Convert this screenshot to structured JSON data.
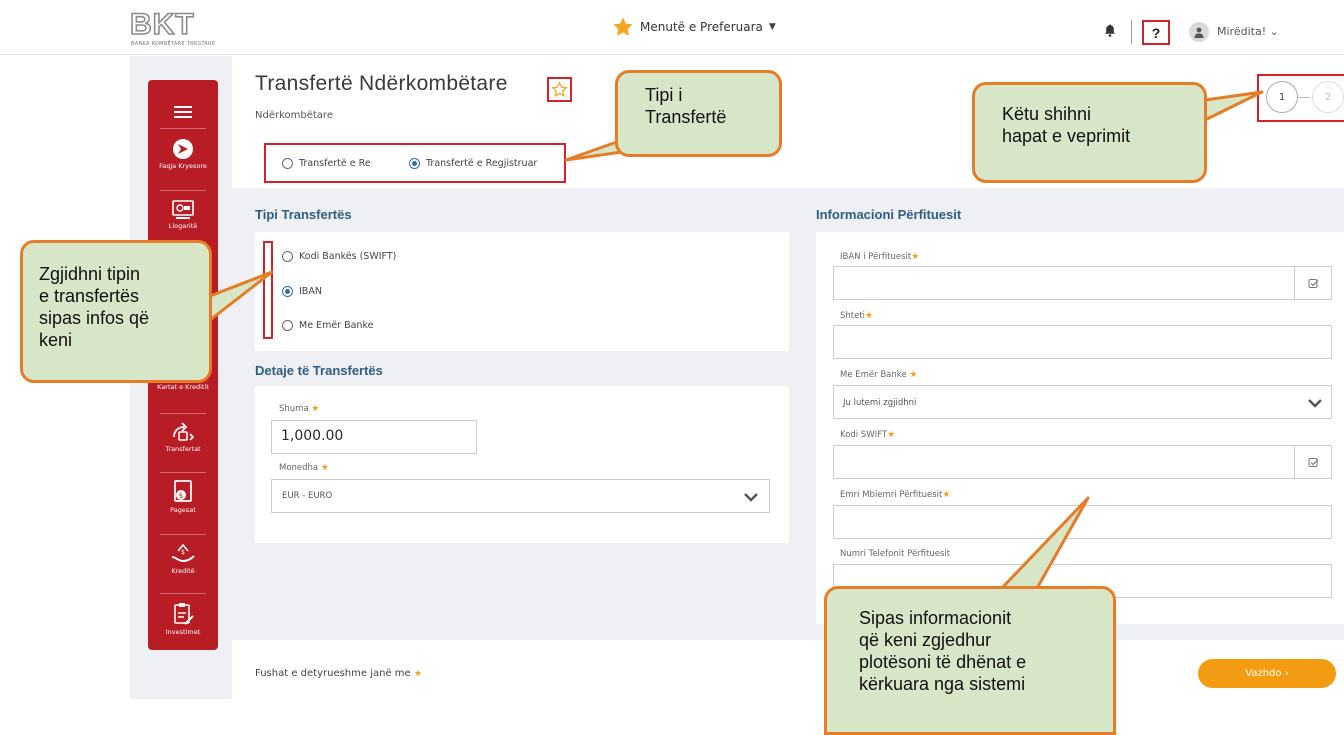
{
  "topbar": {
    "logo_letters": "BKT",
    "logo_sub": "BANKA KOMBËTARE TREGTARE",
    "favorites_menu": "Menutë e Preferuara",
    "help_label": "?",
    "greeting": "Mirëdita! ⌄"
  },
  "sidebar": {
    "items": [
      {
        "label": "Faqja Kryesore",
        "icon": "home-icon"
      },
      {
        "label": "Llogaritë",
        "icon": "account-icon"
      },
      {
        "label": "Kartat e Kreditit",
        "icon": "card-icon"
      },
      {
        "label": "Transfertat",
        "icon": "transfer-icon"
      },
      {
        "label": "Pagesat",
        "icon": "payment-icon"
      },
      {
        "label": "Kreditë",
        "icon": "loan-icon"
      },
      {
        "label": "Investimet",
        "icon": "invest-icon"
      }
    ]
  },
  "page": {
    "title": "Transfertë Ndërkombëtare",
    "subtitle": "Ndërkombëtare",
    "transfer_mode": {
      "options": [
        "Transfertë e Re",
        "Transfertë e Regjistruar"
      ],
      "selected": "Transfertë e Regjistruar"
    },
    "steps": [
      "1",
      "2"
    ],
    "current_step": 1
  },
  "transfer_type": {
    "title": "Tipi Transfertës",
    "options": [
      "Kodi Bankës (SWIFT)",
      "IBAN",
      "Me Emër Banke"
    ],
    "selected": "IBAN"
  },
  "transfer_details": {
    "title": "Detaje të Transfertës",
    "amount_label": "Shuma",
    "amount_value": "1,000.00",
    "currency_label": "Monedha",
    "currency_value": "EUR - EURO"
  },
  "beneficiary": {
    "title": "Informacioni Përfituesit",
    "iban_label": "IBAN i Përfituesit",
    "country_label": "Shteti",
    "bank_name_label": "Me Emër Banke",
    "bank_name_placeholder": "Ju lutemi zgjidhni",
    "swift_label": "Kodi SWIFT",
    "name_label": "Emri Mbiemri Përfituesit",
    "phone_label": "Numri Telefonit Përfituesit"
  },
  "footer": {
    "required_note": "Fushat e detyrueshme janë me",
    "next_button": "Vazhdo ›"
  },
  "callouts": {
    "type": [
      "Tipi i",
      "Transfertë"
    ],
    "steps": [
      "Këtu shihni",
      "hapat e veprimit"
    ],
    "choose": [
      "Zgjidhni tipin",
      "e transfertës",
      "sipas infos që",
      "keni"
    ],
    "fill": [
      "Sipas informacionit",
      "që keni zgjedhur",
      "plotësoni të dhënat e",
      "kërkuara nga sistemi"
    ]
  },
  "colors": {
    "brand_red": "#b81d25",
    "accent_orange": "#f39c12",
    "callout_bg": "#d6e6c6",
    "callout_border": "#e57d28",
    "section_title": "#2e5d80"
  }
}
